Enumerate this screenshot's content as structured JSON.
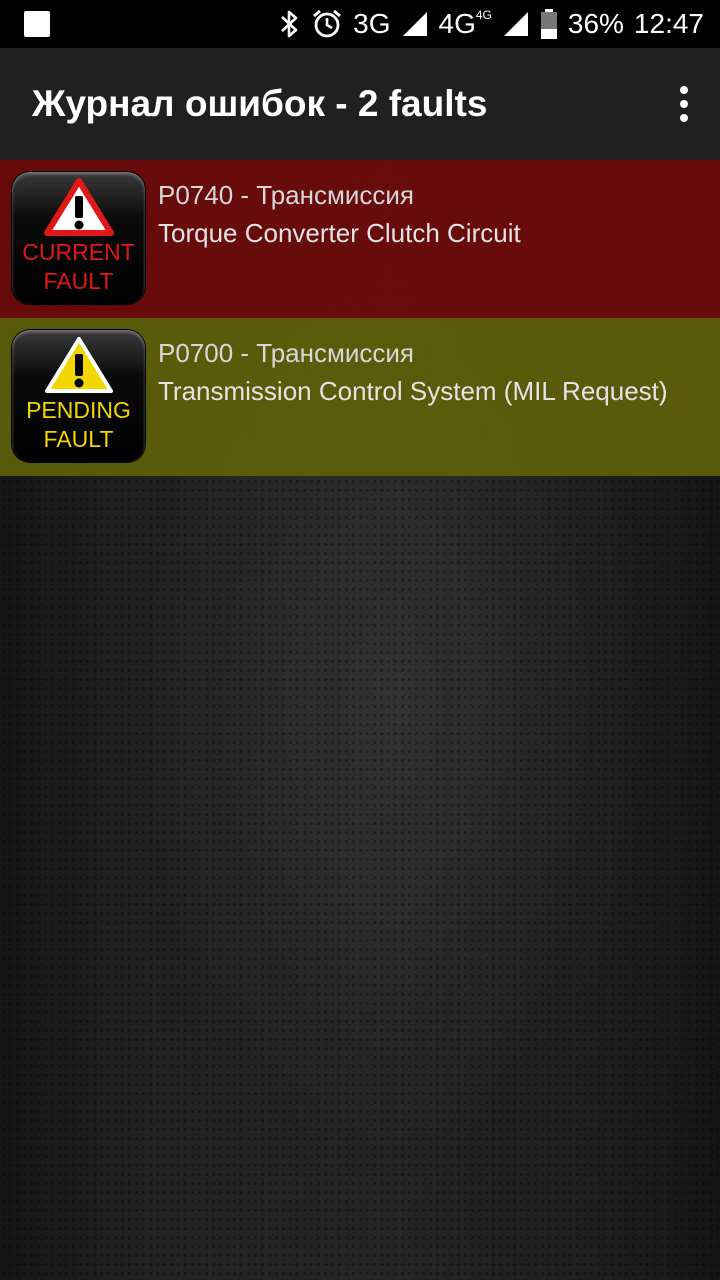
{
  "status_bar": {
    "network_1": "3G",
    "network_2": "4G",
    "network_2_sup": "4G",
    "battery": "36%",
    "time": "12:47",
    "icons": [
      "notification-square-icon",
      "bluetooth-icon",
      "alarm-icon",
      "signal-icon",
      "signal-icon",
      "battery-icon"
    ]
  },
  "app_bar": {
    "title": "Журнал ошибок - 2 faults",
    "menu_icon": "overflow-menu-icon"
  },
  "faults": [
    {
      "badge_line1": "CURRENT",
      "badge_line2": "FAULT",
      "code": "P0740 - Трансмиссия",
      "description": "Torque Converter Clutch Circuit",
      "row_color": "#6e0a0a",
      "badge_color": "#e01818",
      "icon": "warning-triangle-icon"
    },
    {
      "badge_line1": "PENDING",
      "badge_line2": "FAULT",
      "code": "P0700 - Трансмиссия",
      "description": "Transmission Control System (MIL Request)",
      "row_color": "#5f5f0a",
      "badge_color": "#f2d600",
      "icon": "warning-triangle-icon"
    }
  ]
}
